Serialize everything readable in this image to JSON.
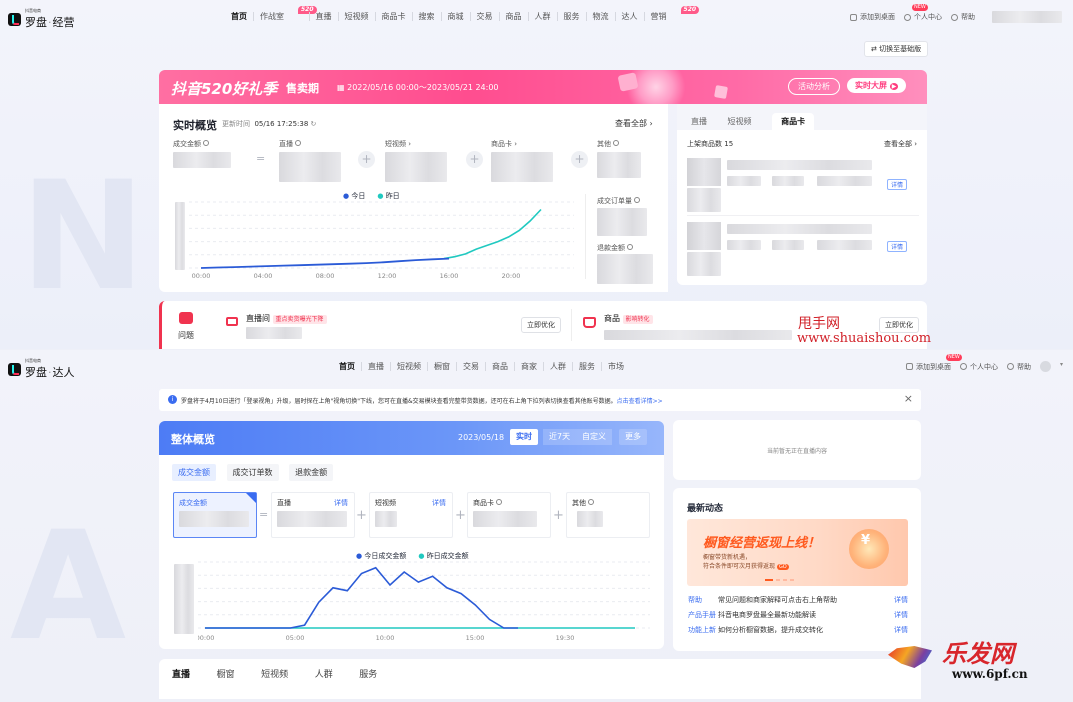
{
  "top": {
    "logo": {
      "small_text": "抖音电商",
      "main_text": "罗盘",
      "suffix": "经营"
    },
    "nav": [
      {
        "label": "首页",
        "active": true
      },
      {
        "label": "作战室",
        "badge": "520"
      },
      {
        "label": "直播"
      },
      {
        "label": "短视频"
      },
      {
        "label": "商品卡"
      },
      {
        "label": "搜索"
      },
      {
        "label": "商城"
      },
      {
        "label": "交易"
      },
      {
        "label": "商品"
      },
      {
        "label": "人群"
      },
      {
        "label": "服务"
      },
      {
        "label": "物流"
      },
      {
        "label": "达人"
      },
      {
        "label": "营销",
        "badge": "520"
      }
    ],
    "tools": {
      "desktop": "添加到桌面",
      "new_badge": "NEW",
      "user_center": "个人中心",
      "help": "帮助"
    },
    "switch_button": "切换至基础版",
    "banner": {
      "title": "抖音520好礼季",
      "subtitle": "售卖期",
      "date_range": "2022/05/16 00:00～2023/05/21 24:00",
      "analysis_button": "活动分析",
      "screen_button": "实时大屏"
    },
    "realtime": {
      "title": "实时概览",
      "update_label": "更新时间",
      "update_time": "05/16 17:25:38",
      "view_all": "查看全部",
      "metrics": {
        "gmv": "成交金额",
        "live": "直播",
        "video": "短视频",
        "card": "商品卡",
        "other": "其他"
      },
      "legend_today": "今日",
      "legend_yesterday": "昨日",
      "x_ticks": [
        "00:00",
        "04:00",
        "08:00",
        "12:00",
        "16:00",
        "20:00"
      ],
      "orders_label": "成交订单量",
      "refund_label": "退款金额"
    },
    "right_panel": {
      "tabs": [
        "直播",
        "短视频",
        "商品卡"
      ],
      "active_tab": "商品卡",
      "products_label": "上架商品数",
      "products_count": "15",
      "view_all": "查看全部",
      "detail": "详情"
    },
    "problem": {
      "label": "问题",
      "live_title": "直播间",
      "live_tag": "重点卖货曝光下降",
      "product_title": "商品",
      "product_tag": "影响转化",
      "optimize": "立即优化"
    }
  },
  "watermark": {
    "brand": "甩手网",
    "url": "www.shuaishou.com"
  },
  "bottom": {
    "logo": {
      "small_text": "抖音电商",
      "main_text": "罗盘",
      "suffix": "达人"
    },
    "nav": [
      {
        "label": "首页",
        "active": true
      },
      {
        "label": "直播"
      },
      {
        "label": "短视频"
      },
      {
        "label": "橱窗"
      },
      {
        "label": "交易"
      },
      {
        "label": "商品"
      },
      {
        "label": "商家"
      },
      {
        "label": "人群"
      },
      {
        "label": "服务"
      },
      {
        "label": "市场"
      }
    ],
    "tools": {
      "desktop": "添加到桌面",
      "new_badge": "NEW",
      "user_center": "个人中心",
      "help": "帮助"
    },
    "notice": {
      "text": "罗盘将于4月10日进行「登录视角」升级，届时探在上角\"视角切换\"下线，您可在直播&交易模块查看完整带货数据，还可在右上角下拉列表切换查看其他账号数据。",
      "link": "点击查看详情>>"
    },
    "overview": {
      "title": "整体概览",
      "date": "2023/05/18",
      "segments": [
        "实时",
        "近7天",
        "自定义",
        "更多"
      ],
      "active_segment": "实时",
      "metric_tabs": [
        "成交金额",
        "成交订单数",
        "退款金额"
      ],
      "active_metric_tab": "成交金额",
      "cards": {
        "gmv": "成交金额",
        "live": "直播",
        "video": "短视频",
        "card": "商品卡",
        "other": "其他",
        "detail": "详情"
      },
      "legend_today": "今日成交金额",
      "legend_yesterday": "昨日成交金额",
      "x_ticks": [
        "00:00",
        "05:00",
        "10:00",
        "15:00",
        "19:30"
      ]
    },
    "live_empty": "当前暂无正在直播内容",
    "news": {
      "title": "最新动态",
      "promo_title": "橱窗经营返现上线！",
      "promo_sub1": "橱窗带货新机遇，",
      "promo_sub2": "符合条件即可次月获得返现",
      "promo_badge": "GO",
      "items": [
        {
          "tag": "帮助",
          "text": "常见问题和商家解释可点击右上角帮助",
          "detail": "详情"
        },
        {
          "tag": "产品手册",
          "text": "抖音电商罗盘最全最新功能解读",
          "detail": "详情"
        },
        {
          "tag": "功能上新",
          "text": "如何分析橱窗数据，提升成交转化",
          "detail": "详情"
        }
      ]
    },
    "bottom_tabs": [
      "直播",
      "橱窗",
      "短视频",
      "人群",
      "服务"
    ],
    "active_bottom_tab": "直播"
  },
  "brand_logo": {
    "text": "乐发网",
    "url": "www.6pf.cn"
  },
  "chart_data": [
    {
      "type": "line",
      "x_ticks": [
        "00:00",
        "04:00",
        "08:00",
        "12:00",
        "16:00",
        "20:00"
      ],
      "series": [
        {
          "name": "今日",
          "color": "#2b5bd7",
          "values": [
            0,
            0.5,
            1,
            1.5,
            2,
            2.5,
            3,
            3.5,
            4,
            4.6,
            5.2,
            6,
            7.2,
            8.4,
            9.2,
            10
          ]
        },
        {
          "name": "昨日",
          "color": "#20c9c0",
          "values": [
            10,
            12,
            15,
            20,
            24,
            28,
            33,
            40,
            50,
            62
          ]
        }
      ]
    },
    {
      "type": "line",
      "x_ticks": [
        "00:00",
        "05:00",
        "10:00",
        "15:00",
        "19:30"
      ],
      "series": [
        {
          "name": "今日成交金额",
          "color": "#2b5bd7",
          "values": [
            0,
            0,
            0,
            0,
            0,
            0,
            0,
            2,
            18,
            28,
            26,
            38,
            42,
            30,
            39,
            32,
            36,
            28,
            24,
            16,
            6,
            0,
            0
          ]
        },
        {
          "name": "昨日成交金额",
          "color": "#20c9c0",
          "values": [
            0,
            0,
            0,
            0,
            0,
            0,
            0,
            0,
            0,
            0,
            0,
            0,
            0,
            0,
            0,
            0,
            0,
            0,
            0,
            0,
            0,
            0,
            0
          ]
        }
      ]
    }
  ]
}
